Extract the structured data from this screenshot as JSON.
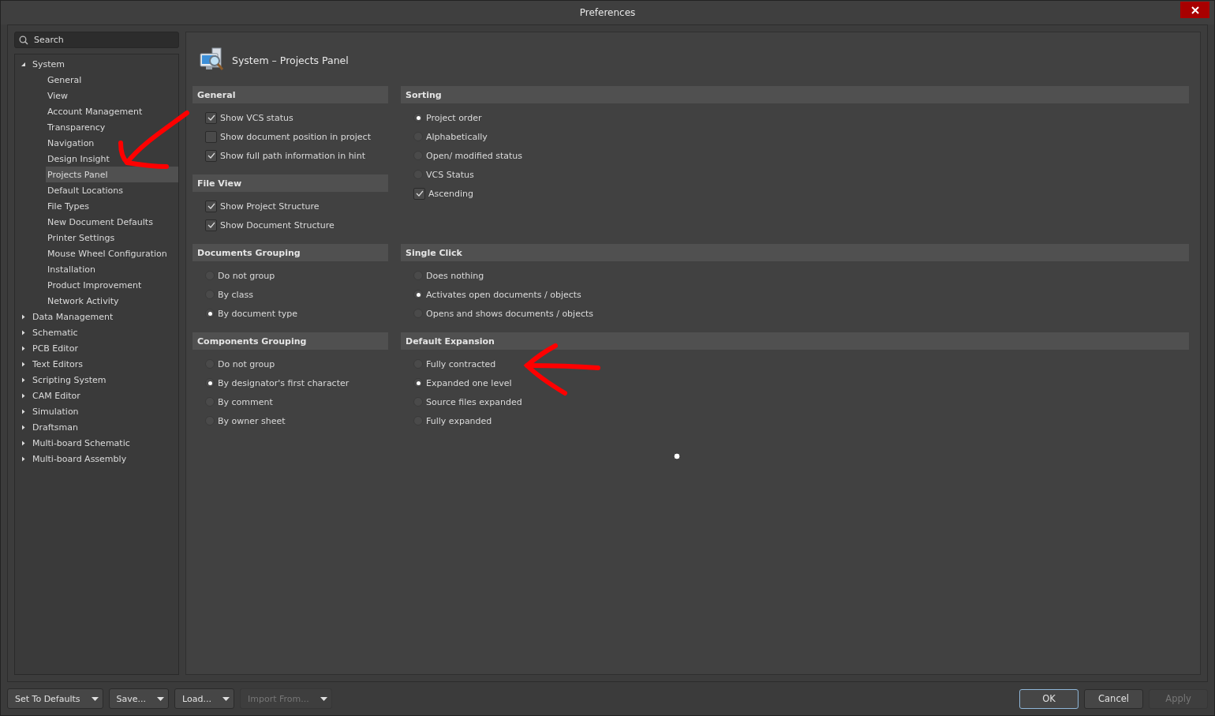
{
  "window": {
    "title": "Preferences"
  },
  "search": {
    "placeholder": "Search"
  },
  "tree": [
    {
      "label": "System",
      "expanded": true,
      "selected": false,
      "children": [
        {
          "label": "General",
          "selected": false
        },
        {
          "label": "View",
          "selected": false
        },
        {
          "label": "Account Management",
          "selected": false
        },
        {
          "label": "Transparency",
          "selected": false
        },
        {
          "label": "Navigation",
          "selected": false
        },
        {
          "label": "Design Insight",
          "selected": false
        },
        {
          "label": "Projects Panel",
          "selected": true
        },
        {
          "label": "Default Locations",
          "selected": false
        },
        {
          "label": "File Types",
          "selected": false
        },
        {
          "label": "New Document Defaults",
          "selected": false
        },
        {
          "label": "Printer Settings",
          "selected": false
        },
        {
          "label": "Mouse Wheel Configuration",
          "selected": false
        },
        {
          "label": "Installation",
          "selected": false
        },
        {
          "label": "Product Improvement",
          "selected": false
        },
        {
          "label": "Network Activity",
          "selected": false
        }
      ]
    },
    {
      "label": "Data Management",
      "expanded": false,
      "selected": false
    },
    {
      "label": "Schematic",
      "expanded": false,
      "selected": false
    },
    {
      "label": "PCB Editor",
      "expanded": false,
      "selected": false
    },
    {
      "label": "Text Editors",
      "expanded": false,
      "selected": false
    },
    {
      "label": "Scripting System",
      "expanded": false,
      "selected": false
    },
    {
      "label": "CAM Editor",
      "expanded": false,
      "selected": false
    },
    {
      "label": "Simulation",
      "expanded": false,
      "selected": false
    },
    {
      "label": "Draftsman",
      "expanded": false,
      "selected": false
    },
    {
      "label": "Multi-board Schematic",
      "expanded": false,
      "selected": false
    },
    {
      "label": "Multi-board Assembly",
      "expanded": false,
      "selected": false
    }
  ],
  "page": {
    "title": "System – Projects Panel"
  },
  "section_rows": [
    {
      "left": [
        {
          "title": "General",
          "options": [
            {
              "kind": "checkbox",
              "label": "Show VCS status",
              "checked": true
            },
            {
              "kind": "checkbox",
              "label": "Show document position in project",
              "checked": false
            },
            {
              "kind": "checkbox",
              "label": "Show full path information in hint",
              "checked": true
            }
          ]
        },
        {
          "title": "File View",
          "options": [
            {
              "kind": "checkbox",
              "label": "Show Project Structure",
              "checked": true
            },
            {
              "kind": "checkbox",
              "label": "Show Document Structure",
              "checked": true
            }
          ]
        }
      ],
      "right": [
        {
          "title": "Sorting",
          "options": [
            {
              "kind": "radio",
              "label": "Project order",
              "selected": true
            },
            {
              "kind": "radio",
              "label": "Alphabetically",
              "selected": false
            },
            {
              "kind": "radio",
              "label": "Open/ modified status",
              "selected": false
            },
            {
              "kind": "radio",
              "label": "VCS Status",
              "selected": false
            },
            {
              "kind": "checkbox",
              "label": "Ascending",
              "checked": true
            }
          ]
        }
      ]
    },
    {
      "left": [
        {
          "title": "Documents Grouping",
          "options": [
            {
              "kind": "radio",
              "label": "Do not group",
              "selected": false
            },
            {
              "kind": "radio",
              "label": "By class",
              "selected": false
            },
            {
              "kind": "radio",
              "label": "By document type",
              "selected": true
            }
          ]
        }
      ],
      "right": [
        {
          "title": "Single Click",
          "options": [
            {
              "kind": "radio",
              "label": "Does nothing",
              "selected": false
            },
            {
              "kind": "radio",
              "label": "Activates open documents / objects",
              "selected": true
            },
            {
              "kind": "radio",
              "label": "Opens and shows documents / objects",
              "selected": false
            }
          ]
        }
      ]
    },
    {
      "left": [
        {
          "title": "Components Grouping",
          "options": [
            {
              "kind": "radio",
              "label": "Do not group",
              "selected": false
            },
            {
              "kind": "radio",
              "label": "By designator's first character",
              "selected": true
            },
            {
              "kind": "radio",
              "label": "By comment",
              "selected": false
            },
            {
              "kind": "radio",
              "label": "By owner sheet",
              "selected": false
            }
          ]
        }
      ],
      "right": [
        {
          "title": "Default Expansion",
          "options": [
            {
              "kind": "radio",
              "label": "Fully contracted",
              "selected": false
            },
            {
              "kind": "radio",
              "label": "Expanded one level",
              "selected": true
            },
            {
              "kind": "radio",
              "label": "Source files expanded",
              "selected": false
            },
            {
              "kind": "radio",
              "label": "Fully expanded",
              "selected": false
            }
          ]
        }
      ]
    }
  ],
  "footer_left": [
    {
      "label": "Set To Defaults",
      "disabled": false
    },
    {
      "label": "Save...",
      "disabled": false
    },
    {
      "label": "Load...",
      "disabled": false
    },
    {
      "label": "Import From...",
      "disabled": true
    }
  ],
  "footer_right": [
    {
      "label": "OK",
      "default": true,
      "disabled": false
    },
    {
      "label": "Cancel",
      "default": false,
      "disabled": false
    },
    {
      "label": "Apply",
      "default": false,
      "disabled": true
    }
  ]
}
